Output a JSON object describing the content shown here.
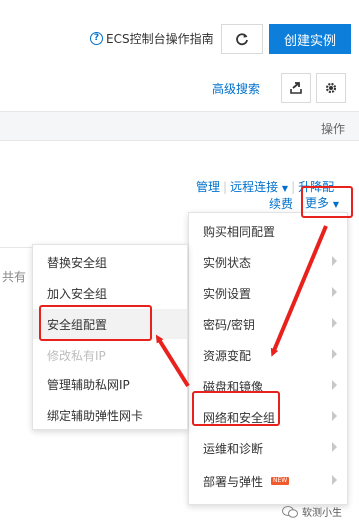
{
  "toolbar": {
    "guide_label": "ECS控制台操作指南",
    "create_label": "创建实例",
    "advanced_search_label": "高级搜索"
  },
  "table": {
    "operations_header": "操作"
  },
  "row": {
    "manage_label": "管理",
    "remote_label": "远程连接",
    "upgrade_label": "升降配",
    "renew_label": "续费",
    "more_label": "更多",
    "partial_text": "共有"
  },
  "main_menu": {
    "items": [
      {
        "label": "购买相同配置",
        "has_submenu": false
      },
      {
        "label": "实例状态",
        "has_submenu": true
      },
      {
        "label": "实例设置",
        "has_submenu": true
      },
      {
        "label": "密码/密钥",
        "has_submenu": true
      },
      {
        "label": "资源变配",
        "has_submenu": true
      },
      {
        "label": "磁盘和镜像",
        "has_submenu": true
      },
      {
        "label": "网络和安全组",
        "has_submenu": true
      },
      {
        "label": "运维和诊断",
        "has_submenu": true
      },
      {
        "label": "部署与弹性",
        "has_submenu": true,
        "badge": "NEW"
      }
    ]
  },
  "sub_menu": {
    "items": [
      {
        "label": "替换安全组",
        "disabled": false
      },
      {
        "label": "加入安全组",
        "disabled": false
      },
      {
        "label": "安全组配置",
        "disabled": false
      },
      {
        "label": "修改私有IP",
        "disabled": true
      },
      {
        "label": "管理辅助私网IP",
        "disabled": false
      },
      {
        "label": "绑定辅助弹性网卡",
        "disabled": false
      }
    ]
  },
  "watermark": {
    "text": "软测小生"
  },
  "colors": {
    "primary": "#0d7ed9",
    "link": "#0070cc",
    "annotation_red": "#e8211d"
  }
}
